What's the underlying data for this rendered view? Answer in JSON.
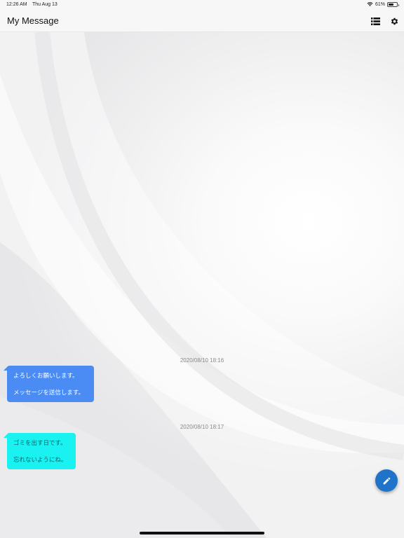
{
  "status_bar": {
    "time": "12:26 AM",
    "date": "Thu Aug 13",
    "battery": "61%",
    "battery_level": 0.61
  },
  "nav": {
    "title": "My Message",
    "list_icon": "list-icon",
    "settings_icon": "gear-icon"
  },
  "messages": [
    {
      "timestamp": "2020/08/10 18:16",
      "lines": [
        "よろしくお願いします。",
        "メッセージを送信します。"
      ],
      "color": "#4a8bf4"
    },
    {
      "timestamp": "2020/08/10 18:17",
      "lines": [
        "ゴミを出す日です。",
        "忘れないようにね。"
      ],
      "color": "#19f2f0"
    }
  ],
  "fab": {
    "icon": "pencil-icon",
    "color": "#1f74c9"
  }
}
